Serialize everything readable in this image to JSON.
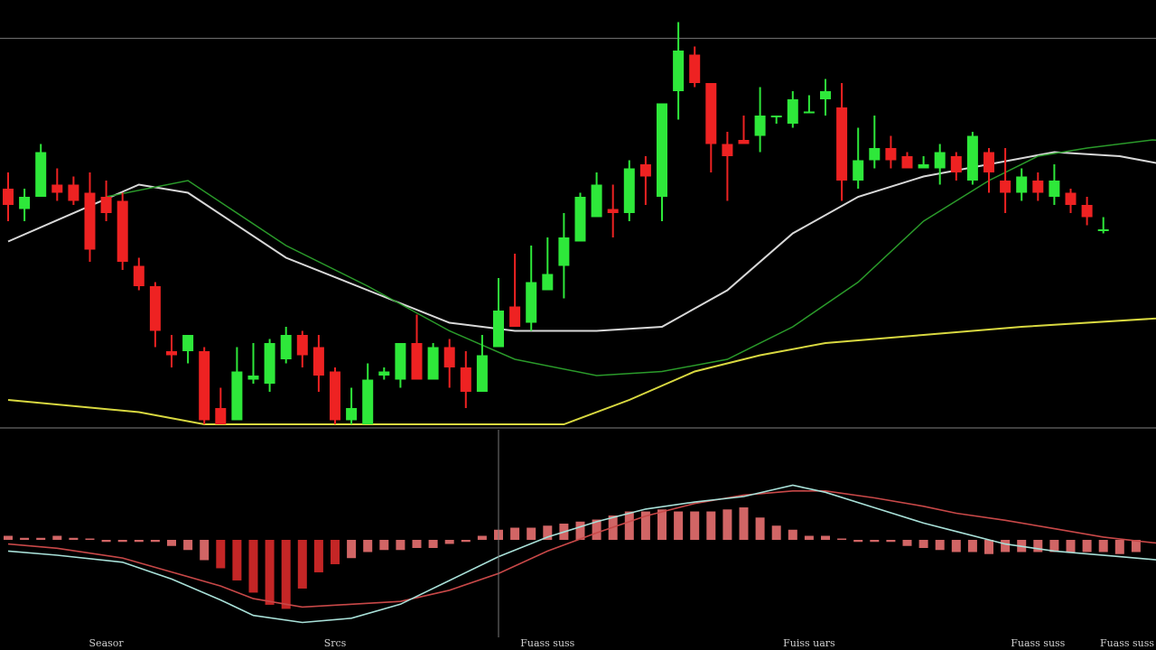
{
  "chart_data": {
    "type": "candlestick",
    "title": "",
    "price_readout": "",
    "theme": {
      "background": "#000000",
      "bull_color": "#2ee83a",
      "bear_color": "#ee2222",
      "ma_fast_color": "#2a9a2a",
      "ma_mid_color": "#d8d8d8",
      "ma_slow_color": "#d8d840",
      "macd_line_color": "#a8e0d8",
      "signal_line_color": "#c84848",
      "hist_color": "#e87070",
      "grid_color": "#666666"
    },
    "y_range": [
      0,
      100
    ],
    "reference_level": 95,
    "candles": [
      {
        "o": 58,
        "h": 62,
        "l": 50,
        "c": 54
      },
      {
        "o": 53,
        "h": 58,
        "l": 50,
        "c": 56
      },
      {
        "o": 56,
        "h": 69,
        "l": 56,
        "c": 67
      },
      {
        "o": 59,
        "h": 63,
        "l": 55,
        "c": 57
      },
      {
        "o": 59,
        "h": 61,
        "l": 54,
        "c": 55
      },
      {
        "o": 57,
        "h": 62,
        "l": 40,
        "c": 43
      },
      {
        "o": 56,
        "h": 60,
        "l": 50,
        "c": 52
      },
      {
        "o": 55,
        "h": 57,
        "l": 38,
        "c": 40
      },
      {
        "o": 39,
        "h": 41,
        "l": 33,
        "c": 34
      },
      {
        "o": 34,
        "h": 35,
        "l": 19,
        "c": 23
      },
      {
        "o": 18,
        "h": 22,
        "l": 14,
        "c": 17
      },
      {
        "o": 18,
        "h": 22,
        "l": 15,
        "c": 22
      },
      {
        "o": 18,
        "h": 19,
        "l": 0,
        "c": 1
      },
      {
        "o": 4,
        "h": 9,
        "l": 0,
        "c": 0
      },
      {
        "o": 1,
        "h": 19,
        "l": 1,
        "c": 13
      },
      {
        "o": 11,
        "h": 20,
        "l": 10,
        "c": 12
      },
      {
        "o": 10,
        "h": 21,
        "l": 8,
        "c": 20
      },
      {
        "o": 16,
        "h": 24,
        "l": 15,
        "c": 22
      },
      {
        "o": 22,
        "h": 23,
        "l": 14,
        "c": 17
      },
      {
        "o": 19,
        "h": 22,
        "l": 8,
        "c": 12
      },
      {
        "o": 13,
        "h": 14,
        "l": 0,
        "c": 1
      },
      {
        "o": 1,
        "h": 9,
        "l": 0,
        "c": 4
      },
      {
        "o": 0,
        "h": 15,
        "l": 0,
        "c": 11
      },
      {
        "o": 12,
        "h": 14,
        "l": 11,
        "c": 13
      },
      {
        "o": 11,
        "h": 20,
        "l": 9,
        "c": 20
      },
      {
        "o": 20,
        "h": 27,
        "l": 11,
        "c": 11
      },
      {
        "o": 11,
        "h": 20,
        "l": 12,
        "c": 19
      },
      {
        "o": 19,
        "h": 21,
        "l": 9,
        "c": 14
      },
      {
        "o": 14,
        "h": 18,
        "l": 4,
        "c": 8
      },
      {
        "o": 8,
        "h": 22,
        "l": 10,
        "c": 17
      },
      {
        "o": 19,
        "h": 36,
        "l": 19,
        "c": 28
      },
      {
        "o": 29,
        "h": 42,
        "l": 24,
        "c": 24
      },
      {
        "o": 25,
        "h": 44,
        "l": 23,
        "c": 35
      },
      {
        "o": 33,
        "h": 46,
        "l": 33,
        "c": 37
      },
      {
        "o": 39,
        "h": 52,
        "l": 31,
        "c": 46
      },
      {
        "o": 45,
        "h": 57,
        "l": 45,
        "c": 56
      },
      {
        "o": 51,
        "h": 62,
        "l": 54,
        "c": 59
      },
      {
        "o": 53,
        "h": 59,
        "l": 46,
        "c": 52
      },
      {
        "o": 52,
        "h": 65,
        "l": 50,
        "c": 63
      },
      {
        "o": 64,
        "h": 66,
        "l": 54,
        "c": 61
      },
      {
        "o": 56,
        "h": 79,
        "l": 50,
        "c": 79
      },
      {
        "o": 82,
        "h": 99,
        "l": 75,
        "c": 92
      },
      {
        "o": 91,
        "h": 93,
        "l": 83,
        "c": 84
      },
      {
        "o": 84,
        "h": 84,
        "l": 62,
        "c": 69
      },
      {
        "o": 69,
        "h": 72,
        "l": 55,
        "c": 66
      },
      {
        "o": 70,
        "h": 76,
        "l": 69,
        "c": 69
      },
      {
        "o": 71,
        "h": 83,
        "l": 67,
        "c": 76
      },
      {
        "o": 76,
        "h": 76,
        "l": 74,
        "c": 76
      },
      {
        "o": 74,
        "h": 82,
        "l": 73,
        "c": 80
      },
      {
        "o": 77,
        "h": 81,
        "l": 77,
        "c": 77
      },
      {
        "o": 80,
        "h": 85,
        "l": 76,
        "c": 82
      },
      {
        "o": 78,
        "h": 84,
        "l": 55,
        "c": 60
      },
      {
        "o": 60,
        "h": 73,
        "l": 58,
        "c": 65
      },
      {
        "o": 65,
        "h": 76,
        "l": 63,
        "c": 68
      },
      {
        "o": 68,
        "h": 71,
        "l": 63,
        "c": 65
      },
      {
        "o": 66,
        "h": 67,
        "l": 63,
        "c": 63
      },
      {
        "o": 63,
        "h": 66,
        "l": 63,
        "c": 64
      },
      {
        "o": 63,
        "h": 69,
        "l": 59,
        "c": 67
      },
      {
        "o": 66,
        "h": 67,
        "l": 60,
        "c": 62
      },
      {
        "o": 60,
        "h": 72,
        "l": 59,
        "c": 71
      },
      {
        "o": 67,
        "h": 68,
        "l": 57,
        "c": 62
      },
      {
        "o": 60,
        "h": 68,
        "l": 52,
        "c": 57
      },
      {
        "o": 57,
        "h": 63,
        "l": 55,
        "c": 61
      },
      {
        "o": 60,
        "h": 62,
        "l": 55,
        "c": 57
      },
      {
        "o": 56,
        "h": 64,
        "l": 54,
        "c": 60
      },
      {
        "o": 57,
        "h": 58,
        "l": 52,
        "c": 54
      },
      {
        "o": 54,
        "h": 56,
        "l": 49,
        "c": 51
      },
      {
        "o": 48,
        "h": 51,
        "l": 47,
        "c": 48
      }
    ],
    "ma_fast": [
      [
        6,
        56
      ],
      [
        11,
        60
      ],
      [
        17,
        44
      ],
      [
        22,
        34
      ],
      [
        27,
        23
      ],
      [
        31,
        16
      ],
      [
        36,
        12
      ],
      [
        40,
        13
      ],
      [
        44,
        16
      ],
      [
        48,
        24
      ],
      [
        52,
        35
      ],
      [
        56,
        50
      ],
      [
        60,
        60
      ],
      [
        63,
        66
      ],
      [
        66,
        68
      ],
      [
        70,
        70
      ],
      [
        74,
        69
      ],
      [
        77,
        66
      ],
      [
        80,
        64
      ]
    ],
    "ma_mid": [
      [
        0,
        45
      ],
      [
        8,
        59
      ],
      [
        11,
        57
      ],
      [
        17,
        41
      ],
      [
        22,
        33
      ],
      [
        27,
        25
      ],
      [
        31,
        23
      ],
      [
        36,
        23
      ],
      [
        40,
        24
      ],
      [
        44,
        33
      ],
      [
        48,
        47
      ],
      [
        52,
        56
      ],
      [
        56,
        61
      ],
      [
        60,
        64
      ],
      [
        64,
        67
      ],
      [
        68,
        66
      ],
      [
        72,
        63
      ],
      [
        76,
        61
      ],
      [
        80,
        60
      ]
    ],
    "ma_slow": [
      [
        0,
        6
      ],
      [
        8,
        3
      ],
      [
        12,
        0
      ],
      [
        29,
        0
      ],
      [
        34,
        0
      ],
      [
        38,
        6
      ],
      [
        42,
        13
      ],
      [
        46,
        17
      ],
      [
        50,
        20
      ],
      [
        56,
        22
      ],
      [
        62,
        24
      ],
      [
        70,
        26
      ],
      [
        80,
        28
      ]
    ],
    "macd": [
      [
        0,
        -8
      ],
      [
        3,
        -11
      ],
      [
        7,
        -16
      ],
      [
        10,
        -28
      ],
      [
        13,
        -43
      ],
      [
        15,
        -54
      ],
      [
        18,
        -59
      ],
      [
        21,
        -56
      ],
      [
        24,
        -46
      ],
      [
        27,
        -29
      ],
      [
        30,
        -12
      ],
      [
        33,
        2
      ],
      [
        36,
        13
      ],
      [
        39,
        22
      ],
      [
        42,
        27
      ],
      [
        45,
        31
      ],
      [
        48,
        39
      ],
      [
        50,
        34
      ],
      [
        53,
        23
      ],
      [
        56,
        12
      ],
      [
        58,
        6
      ],
      [
        61,
        -3
      ],
      [
        64,
        -8
      ],
      [
        68,
        -12
      ],
      [
        72,
        -16
      ],
      [
        76,
        -17
      ],
      [
        80,
        -18
      ]
    ],
    "signal": [
      [
        0,
        -3
      ],
      [
        3,
        -6
      ],
      [
        7,
        -13
      ],
      [
        10,
        -23
      ],
      [
        13,
        -33
      ],
      [
        15,
        -42
      ],
      [
        18,
        -48
      ],
      [
        21,
        -46
      ],
      [
        24,
        -44
      ],
      [
        27,
        -36
      ],
      [
        30,
        -24
      ],
      [
        33,
        -8
      ],
      [
        36,
        5
      ],
      [
        39,
        17
      ],
      [
        42,
        26
      ],
      [
        45,
        32
      ],
      [
        48,
        35
      ],
      [
        50,
        35
      ],
      [
        53,
        30
      ],
      [
        56,
        24
      ],
      [
        58,
        19
      ],
      [
        61,
        14
      ],
      [
        64,
        8
      ],
      [
        67,
        2
      ],
      [
        70,
        -2
      ],
      [
        74,
        -6
      ],
      [
        80,
        -12
      ]
    ],
    "histogram": [
      2,
      1,
      1,
      2,
      1,
      0,
      -1,
      -1,
      -1,
      -1,
      -3,
      -5,
      -10,
      -14,
      -20,
      -26,
      -32,
      -34,
      -24,
      -16,
      -12,
      -9,
      -6,
      -5,
      -5,
      -4,
      -4,
      -2,
      -1,
      2,
      5,
      6,
      6,
      7,
      8,
      9,
      10,
      12,
      14,
      14,
      15,
      14,
      14,
      14,
      15,
      16,
      11,
      7,
      5,
      2,
      2,
      0,
      -1,
      -1,
      -1,
      -3,
      -4,
      -5,
      -6,
      -6,
      -7,
      -6,
      -6,
      -6,
      -6,
      -6,
      -6,
      -6,
      -7,
      -6
    ],
    "x_tick_labels": [
      {
        "index": 6,
        "label": "Seasor"
      },
      {
        "index": 20,
        "label": "Srcs"
      },
      {
        "index": 33,
        "label": "Fuass suss"
      },
      {
        "index": 49,
        "label": "Fuiss uars"
      },
      {
        "index": 63,
        "label": "Fuass suss"
      },
      {
        "index": 78,
        "label": "Fuass suss"
      }
    ],
    "vertical_cursor_index": 30
  }
}
